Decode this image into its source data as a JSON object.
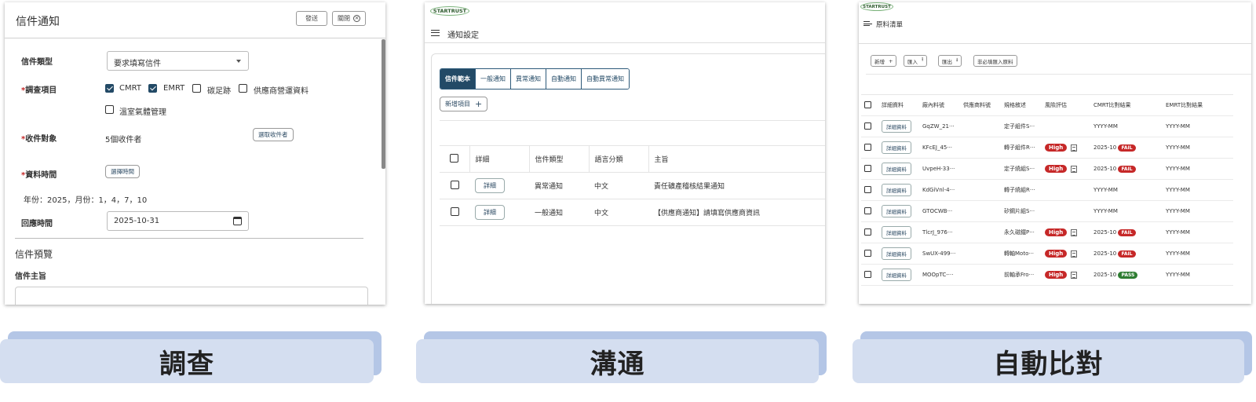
{
  "survey": {
    "title": "信件通知",
    "send_label": "發送",
    "close_label": "關閉",
    "mail_type_label": "信件類型",
    "mail_type_value": "要求填寫信件",
    "required_mark": "*",
    "items_label": "調查項目",
    "items": [
      {
        "label": "CMRT",
        "checked": true
      },
      {
        "label": "EMRT",
        "checked": true
      },
      {
        "label": "碳足跡",
        "checked": false
      },
      {
        "label": "供應商營運資料",
        "checked": false
      },
      {
        "label": "溫室氣體管理",
        "checked": false
      }
    ],
    "recipients_label": "收件對象",
    "recipients_value": "5個收件者",
    "choose_recipients_label": "選取收件者",
    "data_time_label": "資料時間",
    "choose_time_label": "選擇時間",
    "period_text": "年份：2025，月份：1，4，7，10",
    "reply_time_label": "回應時間",
    "reply_time_value": "2025-10-31",
    "preview_title": "信件預覽",
    "subject_label": "信件主旨"
  },
  "comm": {
    "logo": "STARTRUST",
    "page_title": "通知設定",
    "tabs": [
      {
        "label": "信件範本",
        "active": true
      },
      {
        "label": "一般通知",
        "active": false
      },
      {
        "label": "異常通知",
        "active": false
      },
      {
        "label": "自動通知",
        "active": false
      },
      {
        "label": "自動異常通知",
        "active": false
      }
    ],
    "add_label": "新增項目",
    "columns": [
      "詳細",
      "信件類型",
      "語言分類",
      "主旨"
    ],
    "rows": [
      {
        "detail": "詳細",
        "type": "異常通知",
        "lang": "中文",
        "subject": "責任礦產稽核結果通知"
      },
      {
        "detail": "詳細",
        "type": "一般通知",
        "lang": "中文",
        "subject": "【供應商通知】請填寫供應商資訊"
      }
    ]
  },
  "compare": {
    "logo": "STARTRUST",
    "page_title": "原料清單",
    "buttons": {
      "add": "新增",
      "import": "匯入",
      "export": "匯出",
      "nonrequired": "非必填匯入原料"
    },
    "columns": [
      "詳細資料",
      "廠內料號",
      "供應商料號",
      "規格敘述",
      "風險評估",
      "CMRT比對結果",
      "EMRT比對結果"
    ],
    "rows": [
      {
        "detail": "詳細資料",
        "part": "GqZW_21···",
        "supplier": "",
        "spec": "定子組件S···",
        "risk": "",
        "cmrt": "YYYY-MM",
        "cmrt_badge": "",
        "emrt": "YYYY-MM"
      },
      {
        "detail": "詳細資料",
        "part": "KFcEJ_45···",
        "supplier": "",
        "spec": "轉子組件R···",
        "risk": "High",
        "cmrt": "2025-10",
        "cmrt_badge": "FAIL",
        "emrt": "YYYY-MM"
      },
      {
        "detail": "詳細資料",
        "part": "UvpeH-33···",
        "supplier": "",
        "spec": "定子繞組S···",
        "risk": "High",
        "cmrt": "2025-10",
        "cmrt_badge": "FAIL",
        "emrt": "YYYY-MM"
      },
      {
        "detail": "詳細資料",
        "part": "KdGiVnl-4···",
        "supplier": "",
        "spec": "轉子繞組R···",
        "risk": "",
        "cmrt": "YYYY-MM",
        "cmrt_badge": "",
        "emrt": "YYYY-MM"
      },
      {
        "detail": "詳細資料",
        "part": "GTOCWB···",
        "supplier": "",
        "spec": "矽鋼片組S···",
        "risk": "",
        "cmrt": "YYYY-MM",
        "cmrt_badge": "",
        "emrt": "YYYY-MM"
      },
      {
        "detail": "詳細資料",
        "part": "TlcrJ_976···",
        "supplier": "",
        "spec": "永久磁鐵P···",
        "risk": "High",
        "cmrt": "2025-10",
        "cmrt_badge": "FAIL",
        "emrt": "YYYY-MM"
      },
      {
        "detail": "詳細資料",
        "part": "SwUX-499···",
        "supplier": "",
        "spec": "轉軸Moto···",
        "risk": "High",
        "cmrt": "2025-10",
        "cmrt_badge": "FAIL",
        "emrt": "YYYY-MM"
      },
      {
        "detail": "詳細資料",
        "part": "MOOpTC-···",
        "supplier": "",
        "spec": "前軸承Fro···",
        "risk": "High",
        "cmrt": "2025-10",
        "cmrt_badge": "PASS",
        "emrt": "YYYY-MM"
      }
    ]
  },
  "captions": [
    "調查",
    "溝通",
    "自動比對"
  ],
  "colors": {
    "primary": "#234a66",
    "high": "#c62828",
    "pass": "#2e7d32",
    "caption_front": "#d4def0",
    "caption_back": "#b4c6e6"
  }
}
